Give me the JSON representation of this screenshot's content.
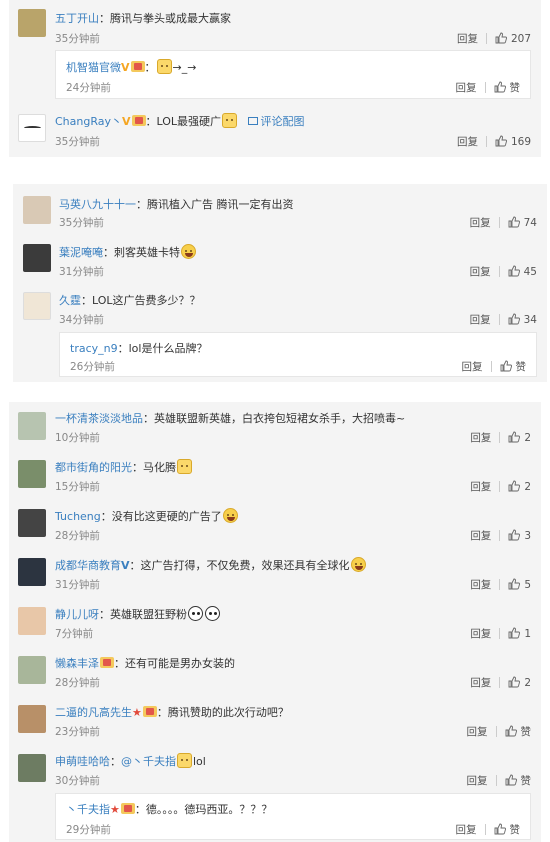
{
  "cards": [
    {
      "comments": [
        {
          "user": "五丁开山",
          "text": "腾讯与拳头或成最大赢家",
          "time": "35分钟前",
          "reply": "回复",
          "likes": "207"
        },
        {
          "sub": true,
          "user": "机智猫官微",
          "vip": "V",
          "text": "→_→",
          "time": "24分钟前",
          "reply": "回复",
          "likes": "赞"
        },
        {
          "user": "ChangRay丶",
          "vip": "V",
          "text": "LOL最强硬广",
          "pic": "评论配图",
          "time": "35分钟前",
          "reply": "回复",
          "likes": "169"
        }
      ]
    },
    {
      "comments": [
        {
          "user": "马英八九十十一",
          "text": "腾讯植入广告 腾讯一定有出资",
          "time": "35分钟前",
          "reply": "回复",
          "likes": "74"
        },
        {
          "user": "葉泥唵唵",
          "text": "刺客英雄卡特",
          "time": "31分钟前",
          "reply": "回复",
          "likes": "45"
        },
        {
          "user": "久霆",
          "text": "LOL这广告费多少？？",
          "time": "34分钟前",
          "reply": "回复",
          "likes": "34"
        },
        {
          "sub": true,
          "user": "tracy_n9",
          "text": "lol是什么品牌？",
          "time": "26分钟前",
          "reply": "回复",
          "likes": "赞"
        }
      ]
    },
    {
      "comments": [
        {
          "user": "一杯清茶淡淡地品",
          "text": "英雄联盟新英雄，白衣挎包短裙女杀手，大招喷毒~",
          "time": "10分钟前",
          "reply": "回复",
          "likes": "2"
        },
        {
          "user": "都市街角的阳光",
          "text": "马化腾",
          "time": "15分钟前",
          "reply": "回复",
          "likes": "2"
        },
        {
          "user": "Tucheng",
          "text": "没有比这更硬的广告了",
          "time": "28分钟前",
          "reply": "回复",
          "likes": "3"
        },
        {
          "user": "成都华商教育",
          "vip": "V",
          "text": "这广告打得，不仅免费，效果还具有全球化",
          "time": "31分钟前",
          "reply": "回复",
          "likes": "5"
        },
        {
          "user": "静儿儿呀",
          "text": "英雄联盟狂野粉",
          "time": "7分钟前",
          "reply": "回复",
          "likes": "1"
        },
        {
          "user": "懒森丰泽",
          "text": "还有可能是男办女装的",
          "time": "28分钟前",
          "reply": "回复",
          "likes": "2"
        },
        {
          "user": "二逼的凡高先生",
          "text": "腾讯赞助的此次行动吧？",
          "time": "23分钟前",
          "reply": "回复",
          "likes": "赞"
        },
        {
          "user": "申萌哇哈哈",
          "text": "@丶千夫指",
          "tail": "lol",
          "time": "30分钟前",
          "reply": "回复",
          "likes": "赞"
        },
        {
          "sub": true,
          "user": "丶千夫指",
          "text": "德。。。。德玛西亚。？？？",
          "time": "29分钟前",
          "reply": "回复",
          "likes": "赞"
        }
      ]
    }
  ]
}
